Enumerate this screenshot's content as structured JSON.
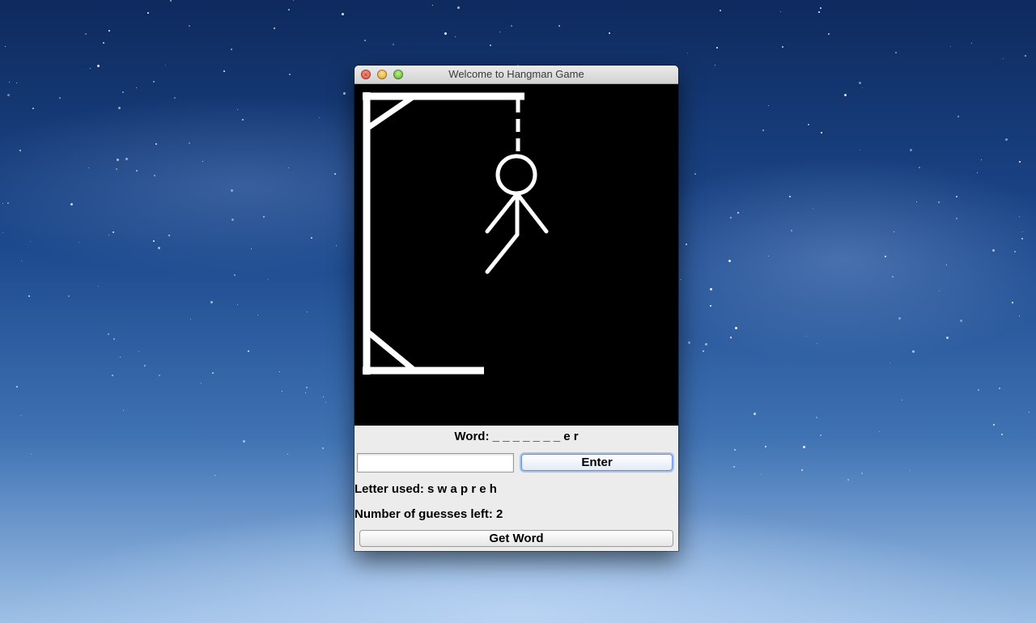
{
  "window": {
    "title": "Welcome to Hangman Game"
  },
  "game": {
    "word_label": "Word:",
    "word_value": "_ _ _ _ _ _ _ e r",
    "letters_label": "Letter used:",
    "letters_value": "s w a p r e h",
    "guesses_label": "Number of guesses left:",
    "guesses_value": "2"
  },
  "controls": {
    "guess_input_value": "",
    "enter_label": "Enter",
    "get_word_label": "Get Word"
  },
  "drawing": {
    "background": "#000000",
    "stroke": "#ffffff",
    "parts_shown": [
      "gallows",
      "rope",
      "head",
      "body",
      "left-arm",
      "right-arm",
      "left-leg"
    ]
  }
}
